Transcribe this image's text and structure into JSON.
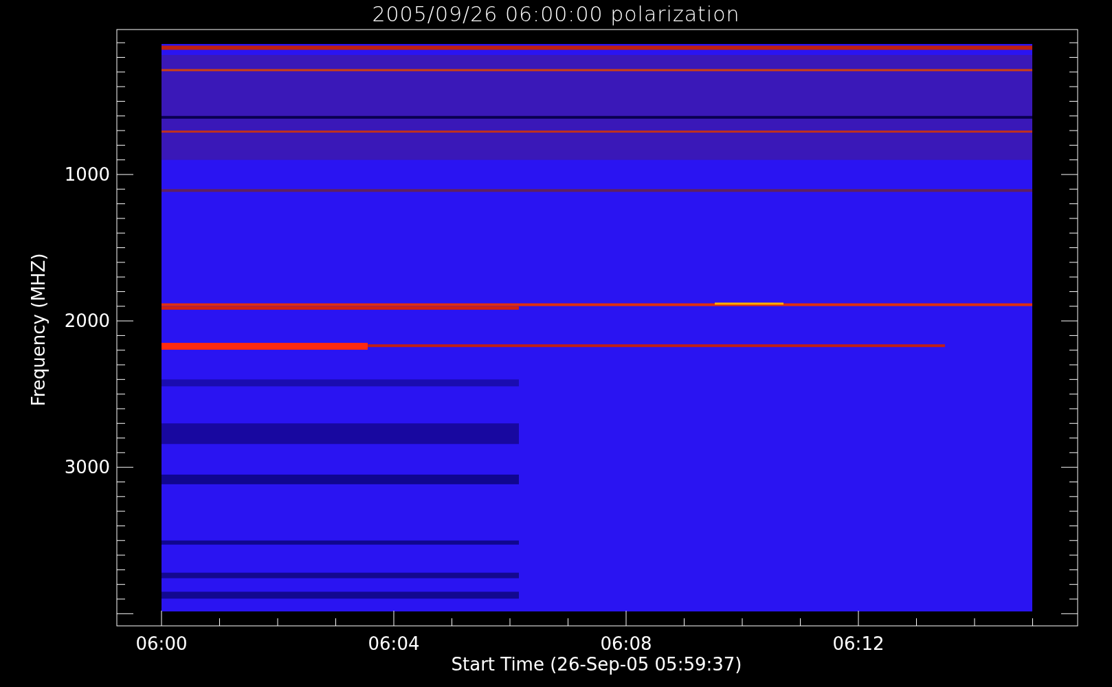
{
  "title": "2005/09/26 06:00:00 polarization",
  "y_axis": {
    "label": "Frequency (MHZ)",
    "ticks": [
      {
        "label": "1000"
      },
      {
        "label": "2000"
      },
      {
        "label": "3000"
      }
    ]
  },
  "x_axis": {
    "label": "Start Time (26-Sep-05 05:59:37)",
    "ticks": [
      {
        "label": "06:00"
      },
      {
        "label": "06:04"
      },
      {
        "label": "06:08"
      },
      {
        "label": "06:12"
      }
    ]
  }
}
